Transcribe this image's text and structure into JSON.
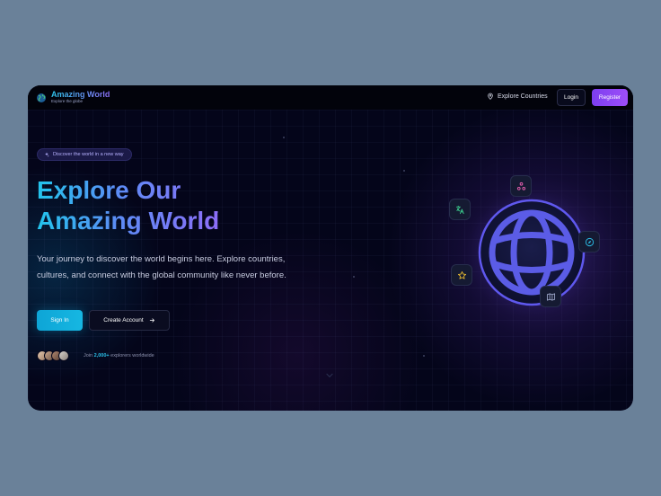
{
  "brand": {
    "title": "Amazing World",
    "subtitle": "Explore the globe",
    "icon": "globe-icon"
  },
  "nav": {
    "explore_label": "Explore Countries",
    "explore_icon": "map-pin-icon",
    "login_label": "Login",
    "register_label": "Register"
  },
  "hero": {
    "badge_icon": "sparkles-icon",
    "badge_text": "Discover the world in a new way",
    "title_line1": "Explore Our",
    "title_line2": "Amazing World",
    "description": "Your journey to discover the world begins here. Explore countries, cultures, and connect with the global community like never before.",
    "signin_label": "Sign In",
    "create_label": "Create Account",
    "create_icon": "arrow-right-icon",
    "join_prefix": "Join",
    "join_count": "2,000+",
    "join_suffix": "explorers worldwide"
  },
  "feature_icons": [
    "translate-icon",
    "users-icon",
    "compass-icon",
    "star-icon",
    "map-icon"
  ],
  "colors": {
    "background": "#04051a",
    "accent_cyan": "#22c4ec",
    "accent_purple": "#8d6ef8",
    "register": "#7d3ef0",
    "globe": "#5b5ce6",
    "page_bg": "#6a8199"
  }
}
